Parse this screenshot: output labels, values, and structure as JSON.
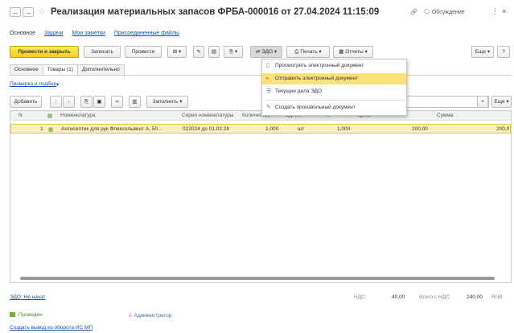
{
  "window": {
    "title": "Реализация материальных запасов ФРБА-000016 от 27.04.2024 11:15:09",
    "discuss_label": "Обсуждение",
    "more_dots": "⋮",
    "close_glyph": "×"
  },
  "nav_tabs": [
    {
      "label": "Основное"
    },
    {
      "label": "Задачи"
    },
    {
      "label": "Мои заметки"
    },
    {
      "label": "Присоединенные файлы"
    }
  ],
  "toolbar": {
    "post_close": "Провести и закрыть",
    "save": "Записать",
    "post": "Провести",
    "edo": "ЭДО",
    "print": "Печать",
    "reports": "Отчеты",
    "more": "Еще",
    "help": "?"
  },
  "subtabs": [
    {
      "label": "Основное"
    },
    {
      "label": "Товары (1)"
    },
    {
      "label": "Дополнительно"
    }
  ],
  "goods": {
    "check_link": "Проверка и подбор",
    "add": "Добавить",
    "fill": "Заполнить",
    "more": "Еще",
    "columns": [
      "N",
      "Номенклатура",
      "Серия номенклатуры",
      "Количество",
      "Ед. и...",
      "К.",
      "Цена",
      "Сумма"
    ],
    "rows": [
      {
        "n": "1",
        "item": "Антисептик для рук Флексольвент А, 50...",
        "series": "022024 до 01.02.28",
        "qty": "1,000",
        "unit": "шт",
        "k": "1,000",
        "price": "200,00",
        "sum": "200,0"
      }
    ]
  },
  "edo_menu": {
    "items": [
      {
        "label": "Просмотреть электронный документ",
        "icon": "document-icon"
      },
      {
        "label": "Отправить электронный документ",
        "icon": "send-icon"
      },
      {
        "label": "Текущие дела ЭДО",
        "icon": "tasks-icon"
      },
      {
        "label": "Создать произвольный документ",
        "icon": "create-icon"
      }
    ]
  },
  "footer": {
    "edo_status": "ЭДО: Не начат",
    "vat_label": "НДС:",
    "vat_value": "40,00",
    "total_label": "Всего с НДС:",
    "total_value": "240,00",
    "currency": "RUB",
    "status": "Проведен",
    "author": "Администратор",
    "create_link": "Создать вывод из оборота ИС МП"
  },
  "colors": {
    "primary_button": "#f5cc1e",
    "menu_highlight": "#fbe27a",
    "link": "#1a4fb4",
    "row_selected": "#fdf0c0"
  }
}
